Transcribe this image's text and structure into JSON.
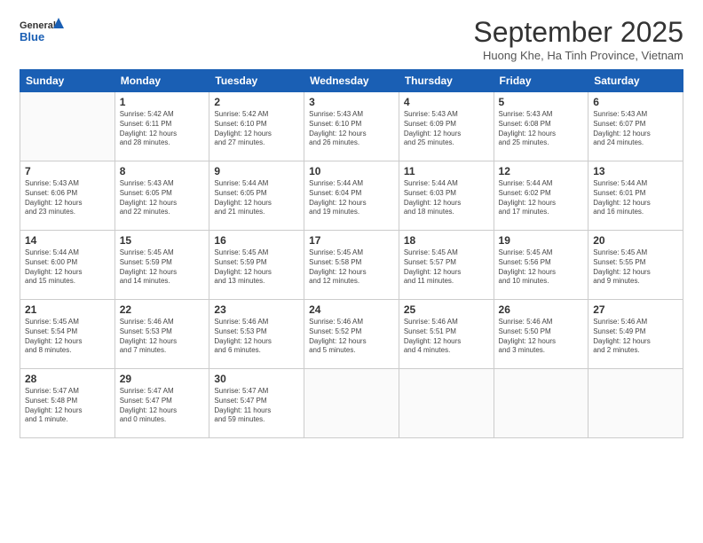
{
  "header": {
    "logo_line1": "General",
    "logo_line2": "Blue",
    "month": "September 2025",
    "location": "Huong Khe, Ha Tinh Province, Vietnam"
  },
  "days_of_week": [
    "Sunday",
    "Monday",
    "Tuesday",
    "Wednesday",
    "Thursday",
    "Friday",
    "Saturday"
  ],
  "weeks": [
    [
      {
        "day": "",
        "info": ""
      },
      {
        "day": "1",
        "info": "Sunrise: 5:42 AM\nSunset: 6:11 PM\nDaylight: 12 hours\nand 28 minutes."
      },
      {
        "day": "2",
        "info": "Sunrise: 5:42 AM\nSunset: 6:10 PM\nDaylight: 12 hours\nand 27 minutes."
      },
      {
        "day": "3",
        "info": "Sunrise: 5:43 AM\nSunset: 6:10 PM\nDaylight: 12 hours\nand 26 minutes."
      },
      {
        "day": "4",
        "info": "Sunrise: 5:43 AM\nSunset: 6:09 PM\nDaylight: 12 hours\nand 25 minutes."
      },
      {
        "day": "5",
        "info": "Sunrise: 5:43 AM\nSunset: 6:08 PM\nDaylight: 12 hours\nand 25 minutes."
      },
      {
        "day": "6",
        "info": "Sunrise: 5:43 AM\nSunset: 6:07 PM\nDaylight: 12 hours\nand 24 minutes."
      }
    ],
    [
      {
        "day": "7",
        "info": "Sunrise: 5:43 AM\nSunset: 6:06 PM\nDaylight: 12 hours\nand 23 minutes."
      },
      {
        "day": "8",
        "info": "Sunrise: 5:43 AM\nSunset: 6:05 PM\nDaylight: 12 hours\nand 22 minutes."
      },
      {
        "day": "9",
        "info": "Sunrise: 5:44 AM\nSunset: 6:05 PM\nDaylight: 12 hours\nand 21 minutes."
      },
      {
        "day": "10",
        "info": "Sunrise: 5:44 AM\nSunset: 6:04 PM\nDaylight: 12 hours\nand 19 minutes."
      },
      {
        "day": "11",
        "info": "Sunrise: 5:44 AM\nSunset: 6:03 PM\nDaylight: 12 hours\nand 18 minutes."
      },
      {
        "day": "12",
        "info": "Sunrise: 5:44 AM\nSunset: 6:02 PM\nDaylight: 12 hours\nand 17 minutes."
      },
      {
        "day": "13",
        "info": "Sunrise: 5:44 AM\nSunset: 6:01 PM\nDaylight: 12 hours\nand 16 minutes."
      }
    ],
    [
      {
        "day": "14",
        "info": "Sunrise: 5:44 AM\nSunset: 6:00 PM\nDaylight: 12 hours\nand 15 minutes."
      },
      {
        "day": "15",
        "info": "Sunrise: 5:45 AM\nSunset: 5:59 PM\nDaylight: 12 hours\nand 14 minutes."
      },
      {
        "day": "16",
        "info": "Sunrise: 5:45 AM\nSunset: 5:59 PM\nDaylight: 12 hours\nand 13 minutes."
      },
      {
        "day": "17",
        "info": "Sunrise: 5:45 AM\nSunset: 5:58 PM\nDaylight: 12 hours\nand 12 minutes."
      },
      {
        "day": "18",
        "info": "Sunrise: 5:45 AM\nSunset: 5:57 PM\nDaylight: 12 hours\nand 11 minutes."
      },
      {
        "day": "19",
        "info": "Sunrise: 5:45 AM\nSunset: 5:56 PM\nDaylight: 12 hours\nand 10 minutes."
      },
      {
        "day": "20",
        "info": "Sunrise: 5:45 AM\nSunset: 5:55 PM\nDaylight: 12 hours\nand 9 minutes."
      }
    ],
    [
      {
        "day": "21",
        "info": "Sunrise: 5:45 AM\nSunset: 5:54 PM\nDaylight: 12 hours\nand 8 minutes."
      },
      {
        "day": "22",
        "info": "Sunrise: 5:46 AM\nSunset: 5:53 PM\nDaylight: 12 hours\nand 7 minutes."
      },
      {
        "day": "23",
        "info": "Sunrise: 5:46 AM\nSunset: 5:53 PM\nDaylight: 12 hours\nand 6 minutes."
      },
      {
        "day": "24",
        "info": "Sunrise: 5:46 AM\nSunset: 5:52 PM\nDaylight: 12 hours\nand 5 minutes."
      },
      {
        "day": "25",
        "info": "Sunrise: 5:46 AM\nSunset: 5:51 PM\nDaylight: 12 hours\nand 4 minutes."
      },
      {
        "day": "26",
        "info": "Sunrise: 5:46 AM\nSunset: 5:50 PM\nDaylight: 12 hours\nand 3 minutes."
      },
      {
        "day": "27",
        "info": "Sunrise: 5:46 AM\nSunset: 5:49 PM\nDaylight: 12 hours\nand 2 minutes."
      }
    ],
    [
      {
        "day": "28",
        "info": "Sunrise: 5:47 AM\nSunset: 5:48 PM\nDaylight: 12 hours\nand 1 minute."
      },
      {
        "day": "29",
        "info": "Sunrise: 5:47 AM\nSunset: 5:47 PM\nDaylight: 12 hours\nand 0 minutes."
      },
      {
        "day": "30",
        "info": "Sunrise: 5:47 AM\nSunset: 5:47 PM\nDaylight: 11 hours\nand 59 minutes."
      },
      {
        "day": "",
        "info": ""
      },
      {
        "day": "",
        "info": ""
      },
      {
        "day": "",
        "info": ""
      },
      {
        "day": "",
        "info": ""
      }
    ]
  ]
}
